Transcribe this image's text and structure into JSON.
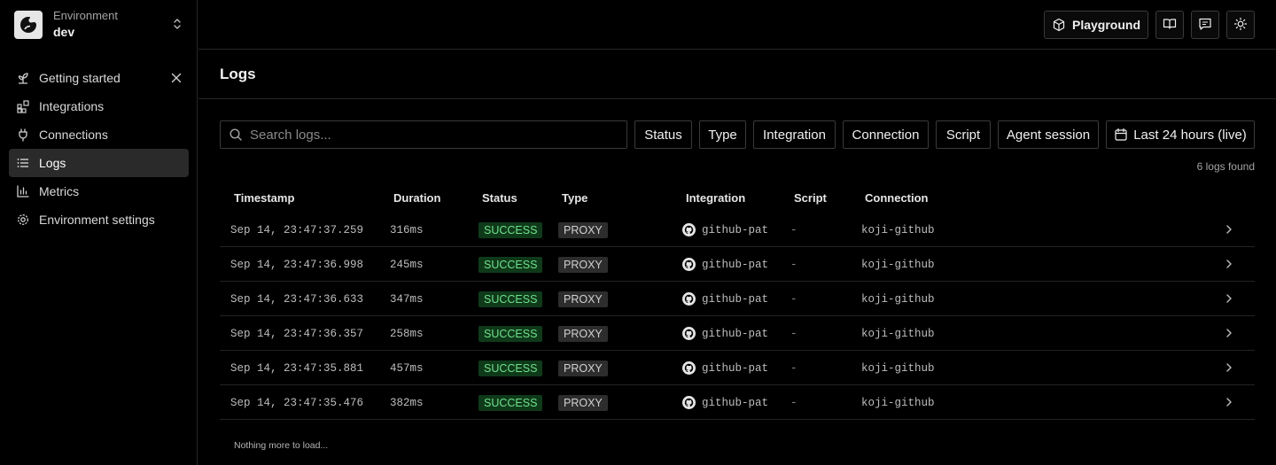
{
  "environment": {
    "label": "Environment",
    "value": "dev"
  },
  "nav": {
    "items": [
      {
        "label": "Getting started",
        "icon": "sprout-icon"
      },
      {
        "label": "Integrations",
        "icon": "integrations-icon"
      },
      {
        "label": "Connections",
        "icon": "plug-icon"
      },
      {
        "label": "Logs",
        "icon": "list-icon",
        "active": true
      },
      {
        "label": "Metrics",
        "icon": "bar-chart-icon"
      },
      {
        "label": "Environment settings",
        "icon": "gear-icon"
      }
    ]
  },
  "topbar": {
    "playground_label": "Playground"
  },
  "page": {
    "title": "Logs"
  },
  "search": {
    "placeholder": "Search logs..."
  },
  "filters": {
    "status": "Status",
    "type": "Type",
    "integration": "Integration",
    "connection": "Connection",
    "script": "Script",
    "agent_session": "Agent session",
    "time_range": "Last 24 hours (live)"
  },
  "logs_count": "6 logs found",
  "table": {
    "headers": {
      "timestamp": "Timestamp",
      "duration": "Duration",
      "status": "Status",
      "type": "Type",
      "integration": "Integration",
      "script": "Script",
      "connection": "Connection"
    },
    "rows": [
      {
        "timestamp": "Sep 14, 23:47:37.259",
        "duration": "316ms",
        "status": "SUCCESS",
        "type": "PROXY",
        "integration": "github-pat",
        "script": "-",
        "connection": "koji-github"
      },
      {
        "timestamp": "Sep 14, 23:47:36.998",
        "duration": "245ms",
        "status": "SUCCESS",
        "type": "PROXY",
        "integration": "github-pat",
        "script": "-",
        "connection": "koji-github"
      },
      {
        "timestamp": "Sep 14, 23:47:36.633",
        "duration": "347ms",
        "status": "SUCCESS",
        "type": "PROXY",
        "integration": "github-pat",
        "script": "-",
        "connection": "koji-github"
      },
      {
        "timestamp": "Sep 14, 23:47:36.357",
        "duration": "258ms",
        "status": "SUCCESS",
        "type": "PROXY",
        "integration": "github-pat",
        "script": "-",
        "connection": "koji-github"
      },
      {
        "timestamp": "Sep 14, 23:47:35.881",
        "duration": "457ms",
        "status": "SUCCESS",
        "type": "PROXY",
        "integration": "github-pat",
        "script": "-",
        "connection": "koji-github"
      },
      {
        "timestamp": "Sep 14, 23:47:35.476",
        "duration": "382ms",
        "status": "SUCCESS",
        "type": "PROXY",
        "integration": "github-pat",
        "script": "-",
        "connection": "koji-github"
      }
    ]
  },
  "footer_note": "Nothing more to load...",
  "colors": {
    "background": "#000000",
    "success": "#6fe08a",
    "success_bg": "#0f3a1a",
    "border": "#3a3a3a"
  }
}
